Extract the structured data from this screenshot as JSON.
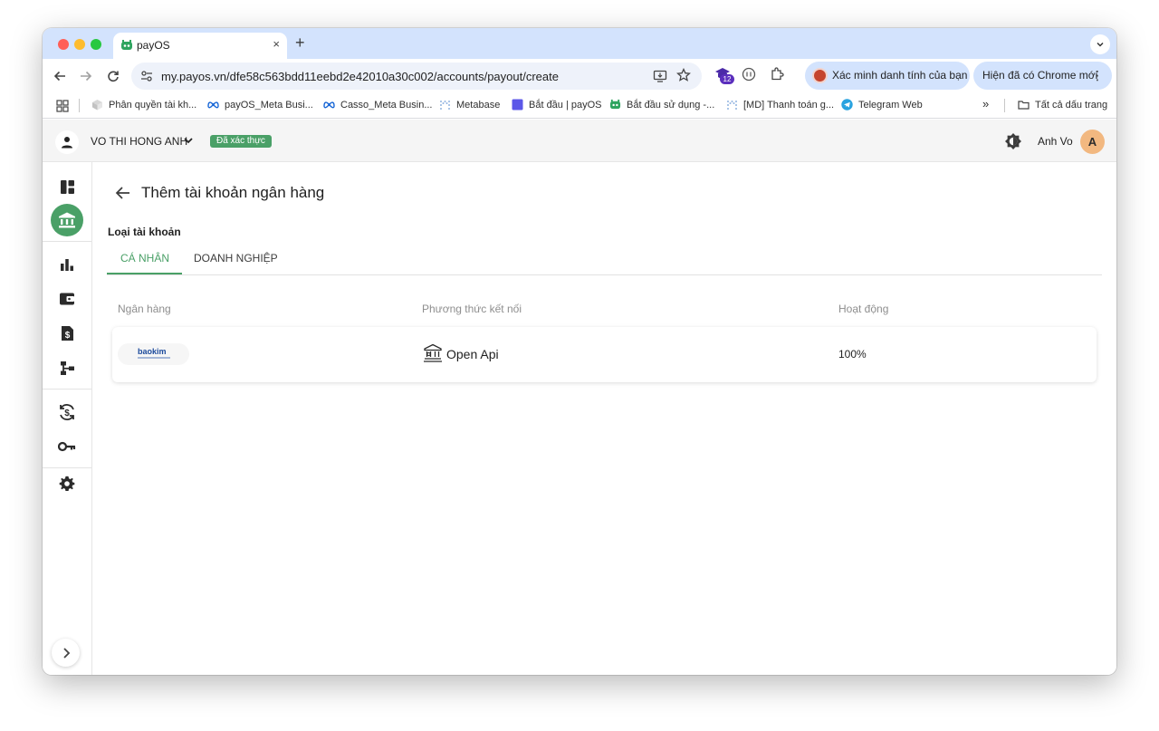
{
  "browser": {
    "tab": {
      "title": "payOS",
      "favicon": "payos-icon",
      "close": "×"
    },
    "new_tab": "+",
    "url": "my.payos.vn/dfe58c563bdd11eebd2e42010a30c002/accounts/payout/create",
    "extension_badge": "12",
    "verify_chip": {
      "text": "Xác minh danh tính của bạn"
    },
    "chrome_update_chip": {
      "text": "Hiện đã có Chrome mới",
      "menu": "⋮"
    },
    "bookmarks": [
      {
        "label": "Phân quyền tài kh...",
        "icon": "cube-icon"
      },
      {
        "label": "payOS_Meta Busi...",
        "icon": "meta-icon"
      },
      {
        "label": "Casso_Meta Busin...",
        "icon": "meta-icon"
      },
      {
        "label": "Metabase",
        "icon": "metabase-icon"
      },
      {
        "label": "Bắt đầu | payOS",
        "icon": "square-icon"
      },
      {
        "label": "Bắt đầu sử dụng -...",
        "icon": "payos-icon"
      },
      {
        "label": "[MD] Thanh toán g...",
        "icon": "metabase-icon"
      },
      {
        "label": "Telegram Web",
        "icon": "telegram-icon"
      }
    ],
    "bookmarks_more": "»",
    "all_bookmarks": "Tất cả dấu trang"
  },
  "header": {
    "org_name": "VO THI HONG ANH",
    "verified_badge": "Đã xác thực",
    "account_name": "Anh Vo",
    "avatar_letter": "A"
  },
  "page": {
    "title": "Thêm tài khoản ngân hàng",
    "account_type_label": "Loại tài khoản",
    "tabs": [
      {
        "label": "CÁ NHÂN",
        "active": true
      },
      {
        "label": "DOANH NGHIỆP",
        "active": false
      }
    ],
    "table": {
      "columns": [
        "Ngân hàng",
        "Phương thức kết nối",
        "Hoạt động"
      ],
      "rows": [
        {
          "bank_logo": "baokim",
          "method": "Open Api",
          "uptime": "100%"
        }
      ]
    }
  },
  "colors": {
    "accent": "#4aa067",
    "tab_strip": "#d3e3fd"
  }
}
